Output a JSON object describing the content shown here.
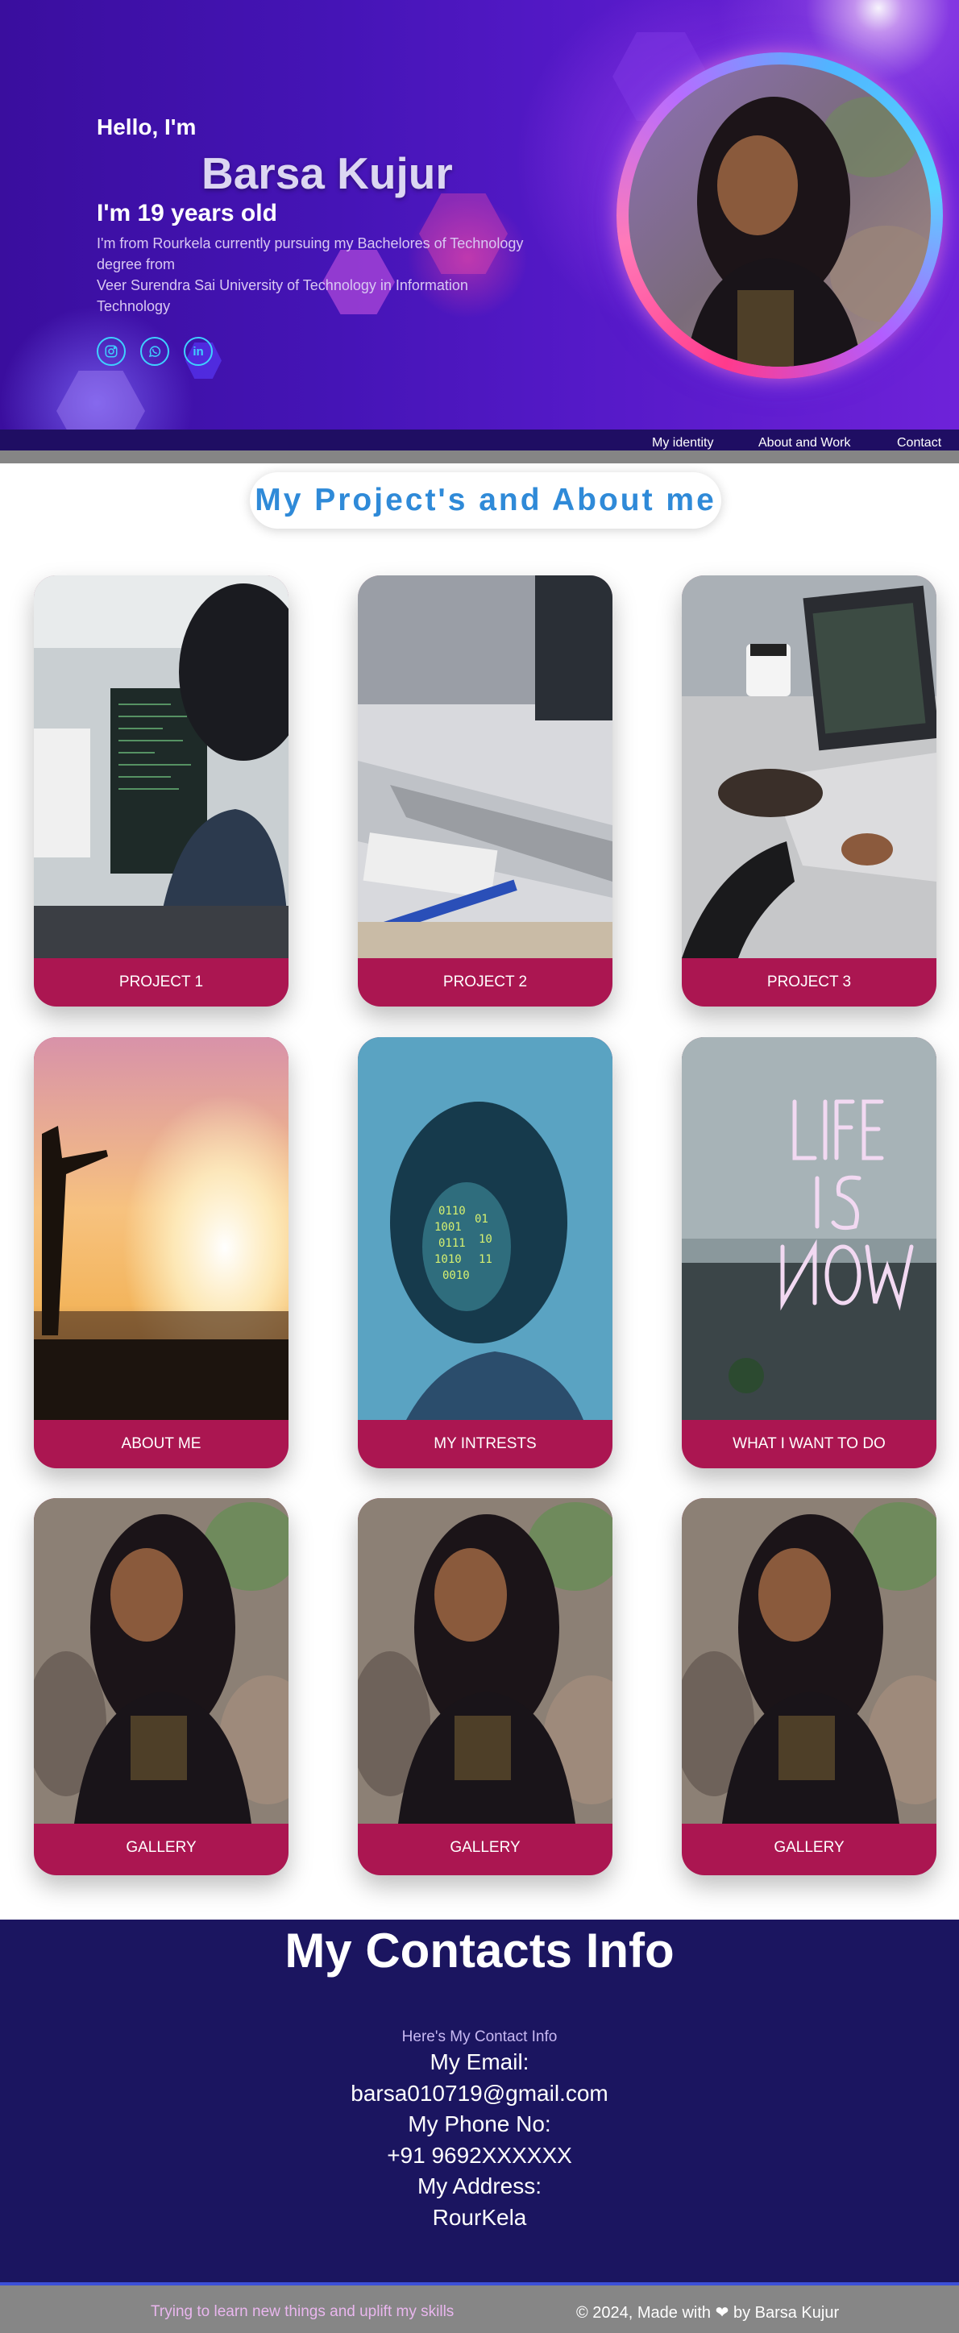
{
  "hero": {
    "greeting": "Hello, I'm",
    "name": "Barsa Kujur",
    "age": "I'm 19 years old",
    "bio_lines": [
      "I'm from Rourkela currently pursuing my Bachelores of Technology",
      "degree from",
      "Veer Surendra Sai University of Technology in Information",
      "Technology"
    ],
    "socials": [
      {
        "icon": "instagram-icon"
      },
      {
        "icon": "whatsapp-icon"
      },
      {
        "icon": "linkedin-icon",
        "text": "in"
      }
    ]
  },
  "nav": {
    "items": [
      {
        "label": "My identity"
      },
      {
        "label": "About and Work"
      },
      {
        "label": "Contact"
      }
    ]
  },
  "projects": {
    "title": "My Project's and About me",
    "cards": [
      {
        "label": "PROJECT 1",
        "image": "person-coding-monitors"
      },
      {
        "label": "PROJECT 2",
        "image": "laptop-notebook-pen"
      },
      {
        "label": "PROJECT 3",
        "image": "laptop-coffee-phone"
      },
      {
        "label": "ABOUT ME",
        "image": "sunset-silhouette"
      },
      {
        "label": "MY INTRESTS",
        "image": "woman-code-projection"
      },
      {
        "label": "WHAT I WANT TO DO",
        "image": "neon-life-is-now"
      },
      {
        "label": "GALLERY",
        "image": "portrait-photo"
      },
      {
        "label": "GALLERY",
        "image": "portrait-photo"
      },
      {
        "label": "GALLERY",
        "image": "portrait-photo"
      }
    ]
  },
  "contact": {
    "title": "My Contacts Info",
    "subtitle": "Here's My Contact Info",
    "email_label": "My Email:",
    "email": "barsa010719@gmail.com",
    "phone_label": "My Phone No:",
    "phone": "+91 9692XXXXXX",
    "address_label": "My Address:",
    "address": "RourKela"
  },
  "footer": {
    "tagline": "Trying to learn new things and uplift my skills",
    "credit_pre": "© 2024, Made with",
    "heart_icon": "heart-icon",
    "credit_post": "by Barsa Kujur"
  },
  "colors": {
    "accent": "#2f8ad8",
    "card_label_bg": "#ab1651",
    "contact_bg": "#1b1560",
    "navbar_bg": "#1f0e63"
  }
}
